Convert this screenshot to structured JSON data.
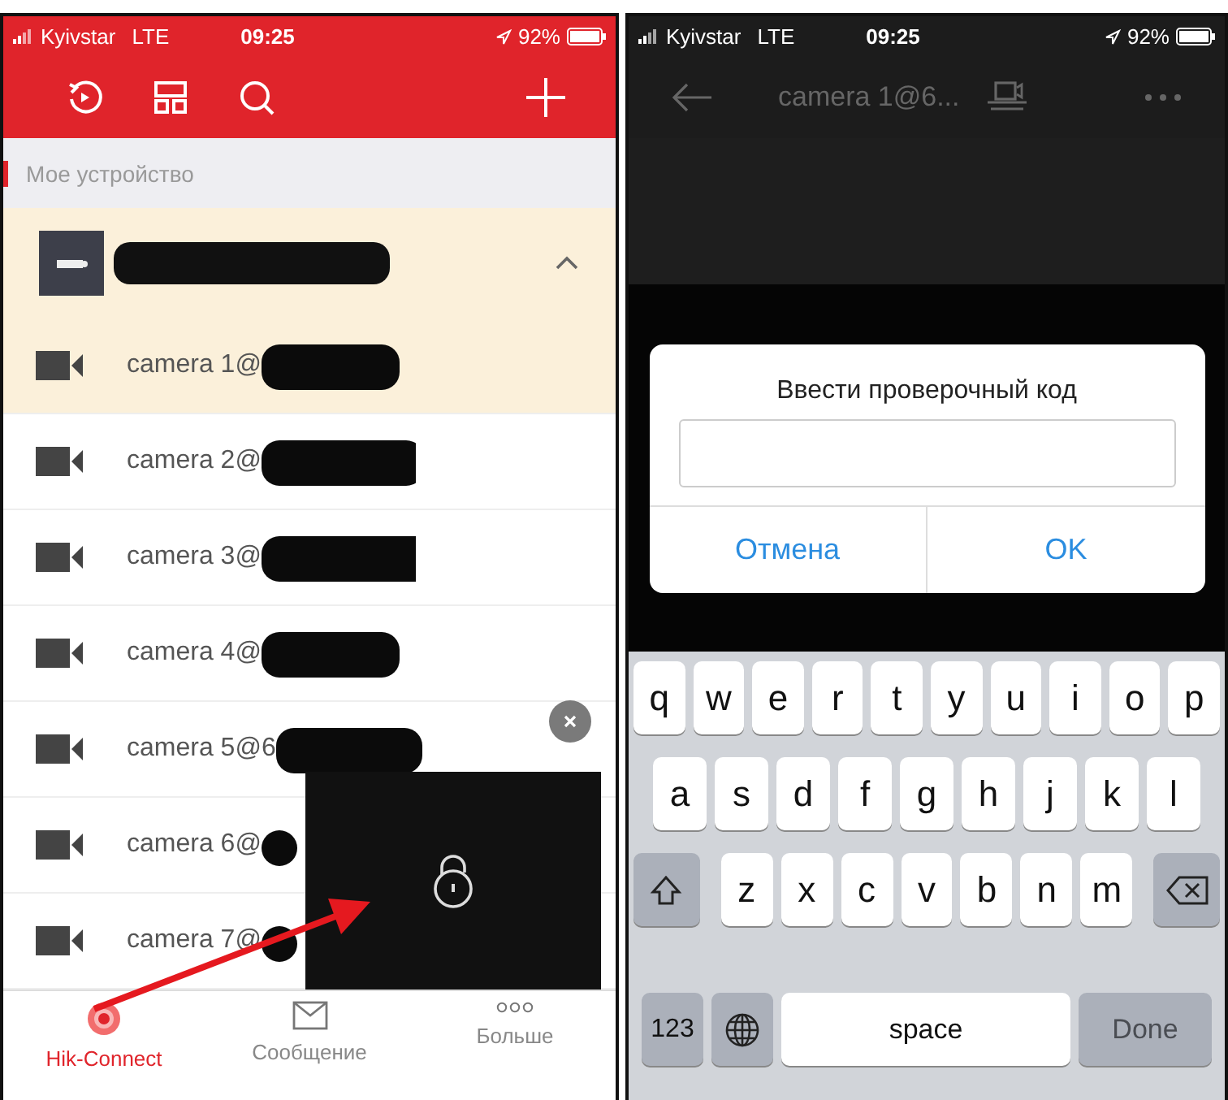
{
  "left_screen": {
    "status_bar": {
      "carrier": "Kyivstar",
      "network": "LTE",
      "time": "09:25",
      "battery": "92%"
    },
    "section_title": "Мое устройство",
    "device": {
      "expanded": true,
      "redacted": true
    },
    "cameras": [
      {
        "name": "camera 1@",
        "selected": true,
        "redacted": true
      },
      {
        "name": "camera 2@",
        "selected": false,
        "redacted": true
      },
      {
        "name": "camera 3@",
        "selected": false,
        "redacted": true
      },
      {
        "name": "camera 4@",
        "selected": false,
        "redacted": true
      },
      {
        "name": "camera 5@6",
        "selected": false,
        "redacted": true
      },
      {
        "name": "camera 6@",
        "selected": false,
        "redacted": true
      },
      {
        "name": "camera 7@",
        "selected": false,
        "redacted": true
      }
    ],
    "tabs": [
      {
        "label": "Hik-Connect",
        "kind": "home",
        "selected": true
      },
      {
        "label": "Сообщение",
        "kind": "message",
        "selected": false
      },
      {
        "label": "Больше",
        "kind": "more",
        "selected": false
      }
    ]
  },
  "right_screen": {
    "status_bar": {
      "carrier": "Kyivstar",
      "network": "LTE",
      "time": "09:25",
      "battery": "92%"
    },
    "title": "camera 1@6...",
    "dialog": {
      "title": "Ввести проверочный код",
      "buttons": [
        "Отмена",
        "OK"
      ]
    },
    "keyboard": [
      [
        {
          "kind": "letter",
          "label": "q"
        },
        {
          "kind": "letter",
          "label": "w"
        },
        {
          "kind": "letter",
          "label": "e"
        },
        {
          "kind": "letter",
          "label": "r"
        },
        {
          "kind": "letter",
          "label": "t"
        },
        {
          "kind": "letter",
          "label": "y"
        },
        {
          "kind": "letter",
          "label": "u"
        },
        {
          "kind": "letter",
          "label": "i"
        },
        {
          "kind": "letter",
          "label": "o"
        },
        {
          "kind": "letter",
          "label": "p"
        }
      ],
      [
        {
          "kind": "letter",
          "label": "a"
        },
        {
          "kind": "letter",
          "label": "s"
        },
        {
          "kind": "letter",
          "label": "d"
        },
        {
          "kind": "letter",
          "label": "f"
        },
        {
          "kind": "letter",
          "label": "g"
        },
        {
          "kind": "letter",
          "label": "h"
        },
        {
          "kind": "letter",
          "label": "j"
        },
        {
          "kind": "letter",
          "label": "k"
        },
        {
          "kind": "letter",
          "label": "l"
        }
      ],
      [
        {
          "kind": "shift"
        },
        {
          "kind": "letter",
          "label": "z"
        },
        {
          "kind": "letter",
          "label": "x"
        },
        {
          "kind": "letter",
          "label": "c"
        },
        {
          "kind": "letter",
          "label": "v"
        },
        {
          "kind": "letter",
          "label": "b"
        },
        {
          "kind": "letter",
          "label": "n"
        },
        {
          "kind": "letter",
          "label": "m"
        },
        {
          "kind": "delete"
        }
      ],
      [
        {
          "kind": "function",
          "label": "123"
        },
        {
          "kind": "globe"
        },
        {
          "kind": "space",
          "label": "space"
        },
        {
          "kind": "done",
          "label": "Done"
        }
      ]
    ]
  }
}
